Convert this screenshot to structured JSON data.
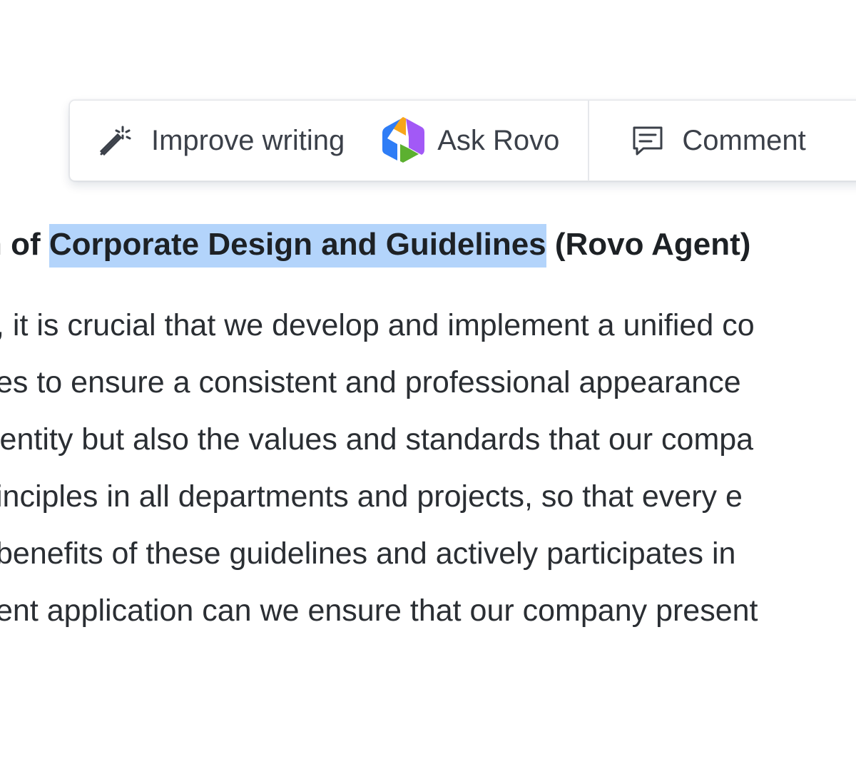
{
  "toolbar": {
    "improve_label": "Improve writing",
    "rovo_label": "Ask Rovo",
    "comment_label": "Comment",
    "icons": {
      "improve": "magic-wand-icon",
      "rovo": "rovo-logo-icon",
      "comment": "comment-icon"
    },
    "rovo_colors": [
      "#f7a51b",
      "#a259f6",
      "#2f7df6",
      "#5cb030"
    ]
  },
  "document": {
    "heading_pre": "n of ",
    "heading_selected": "Corporate Design and Guidelines",
    "heading_post": " (Rovo Agent)",
    "paragraph_lines": [
      ", it is crucial that we develop and implement a unified co",
      "es to ensure a consistent and professional appearance",
      "lentity but also the values and standards that our compa",
      "inciples in all departments and projects, so that every e",
      "benefits of these guidelines and actively participates in",
      "ent application can we ensure that our company present"
    ],
    "selection_color": "#b3d4fb"
  }
}
